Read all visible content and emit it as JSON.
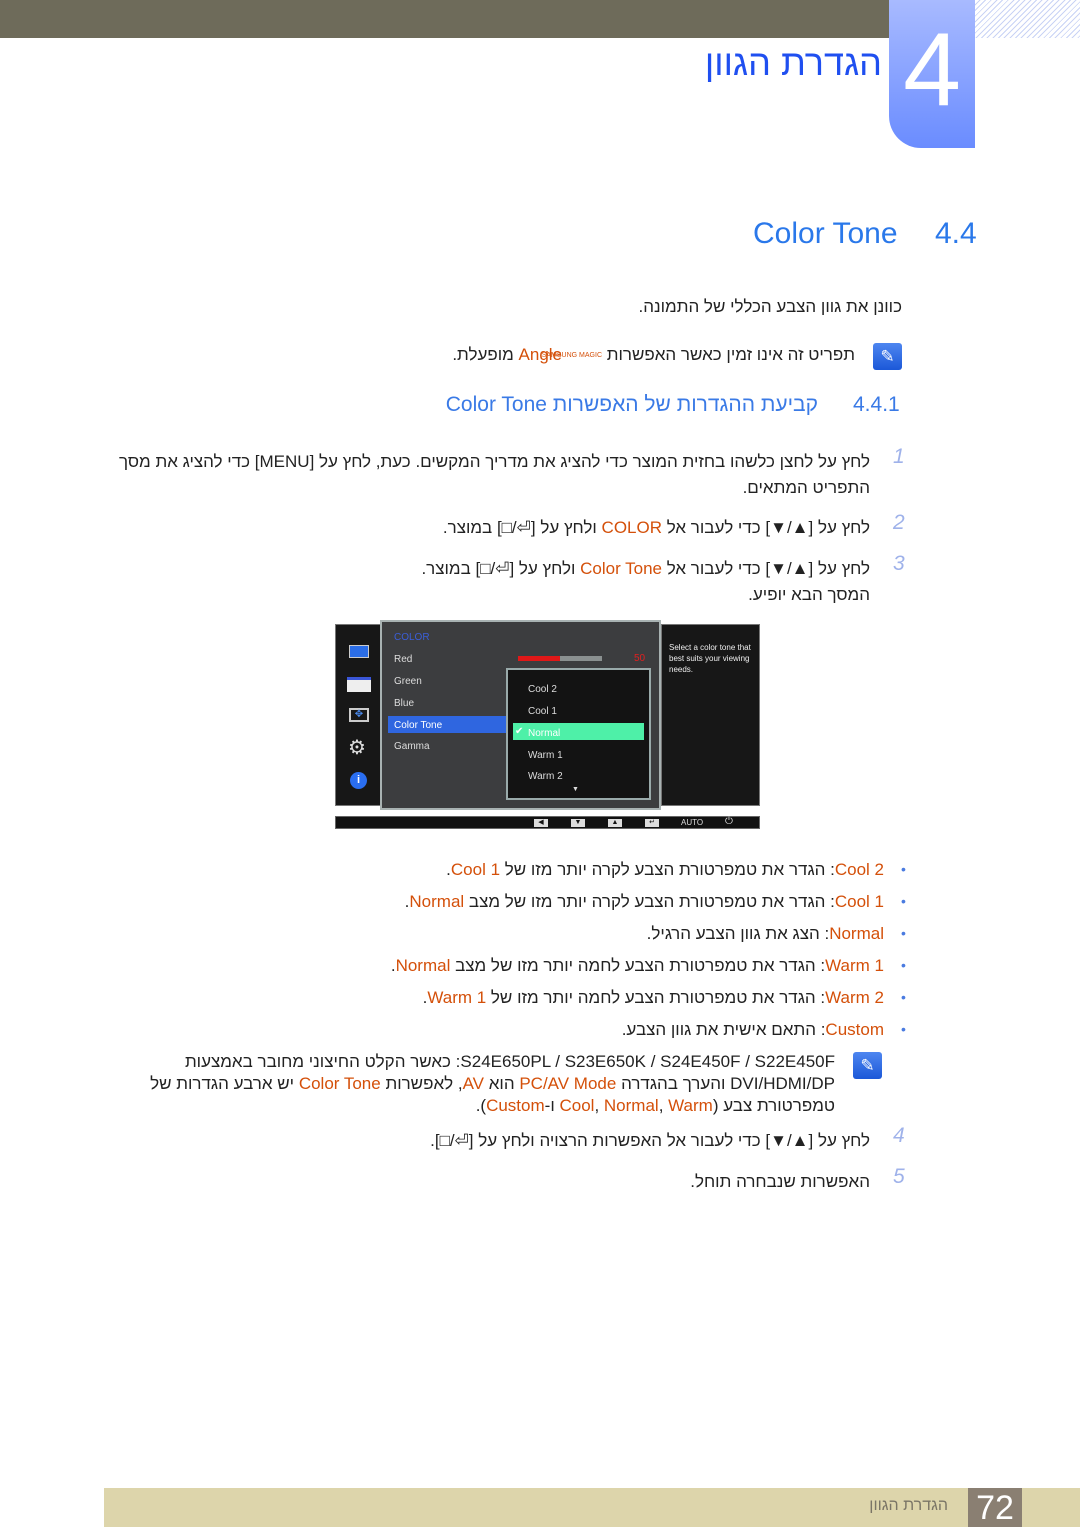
{
  "header": {
    "chapter_number": "4",
    "chapter_title": "הגדרת הגוון"
  },
  "section": {
    "number": "4.4",
    "title": "Color Tone"
  },
  "intro": "כוונן את גוון הצבע הכללי של התמונה.",
  "note1": [
    {
      "t": "תפריט זה אינו זמין כאשר האפשרות "
    },
    {
      "t": "SAMSUNG MAGIC",
      "c": "logo"
    },
    {
      "t": "Angle",
      "c": "o"
    },
    {
      "t": " מופעלת."
    }
  ],
  "subsection": {
    "number": "4.4.1",
    "title": "קביעת ההגדרות של האפשרות Color Tone"
  },
  "steps": [
    {
      "n": "1",
      "lines": [
        [
          {
            "t": "לחץ על לחצן כלשהו בחזית המוצר כדי להציג את מדריך המקשים. כעת, לחץ על [MENU] כדי להציג את מסך"
          }
        ],
        [
          {
            "t": "התפריט המתאים."
          }
        ]
      ]
    },
    {
      "n": "2",
      "lines": [
        [
          {
            "t": "לחץ על [▲/▼] כדי לעבור אל "
          },
          {
            "t": "COLOR",
            "c": "o"
          },
          {
            "t": " ולחץ על [⏎/□] במוצר."
          }
        ]
      ]
    },
    {
      "n": "3",
      "lines": [
        [
          {
            "t": "לחץ על [▲/▼] כדי לעבור אל "
          },
          {
            "t": "Color Tone",
            "c": "o"
          },
          {
            "t": " ולחץ על [⏎/□] במוצר."
          }
        ],
        [
          {
            "t": "המסך הבא יופיע."
          }
        ]
      ]
    },
    {
      "n": "4",
      "lines": [
        [
          {
            "t": "לחץ על [▲/▼] כדי לעבור אל האפשרות הרצויה ולחץ על [⏎/□]."
          }
        ]
      ]
    },
    {
      "n": "5",
      "lines": [
        [
          {
            "t": "האפשרות שנבחרה תוחל."
          }
        ]
      ]
    }
  ],
  "osd": {
    "menu_title": "COLOR",
    "items": [
      "Red",
      "Green",
      "Blue",
      "Color Tone",
      "Gamma"
    ],
    "selected_item": "Color Tone",
    "red_value": "50",
    "red_level": 50,
    "options": [
      "Cool 2",
      "Cool 1",
      "Normal",
      "Warm 1",
      "Warm 2"
    ],
    "selected_option": "Normal",
    "help": "Select a color tone that best suits your viewing needs.",
    "bottom_auto": "AUTO",
    "colors": {
      "highlight": "#2f66e0",
      "option_highlight": "#4ef0a8",
      "title": "#3b5ed8",
      "value": "#e02020"
    }
  },
  "bullets": [
    [
      {
        "t": "Cool 2",
        "c": "o"
      },
      {
        "t": ": הגדר את טמפרטורת הצבע לקרה יותר מזו של "
      },
      {
        "t": "Cool 1",
        "c": "o"
      },
      {
        "t": "."
      }
    ],
    [
      {
        "t": "Cool 1",
        "c": "o"
      },
      {
        "t": ": הגדר את טמפרטורת הצבע לקרה יותר מזו של מצב "
      },
      {
        "t": "Normal",
        "c": "o"
      },
      {
        "t": "."
      }
    ],
    [
      {
        "t": "Normal",
        "c": "o"
      },
      {
        "t": ": הצג את גוון הצבע הרגיל."
      }
    ],
    [
      {
        "t": "Warm 1",
        "c": "o"
      },
      {
        "t": ": הגדר את טמפרטורת הצבע לחמה יותר מזו של מצב "
      },
      {
        "t": "Normal",
        "c": "o"
      },
      {
        "t": "."
      }
    ],
    [
      {
        "t": "Warm 2",
        "c": "o"
      },
      {
        "t": ": הגדר את טמפרטורת הצבע לחמה יותר מזו של "
      },
      {
        "t": "Warm 1",
        "c": "o"
      },
      {
        "t": "."
      }
    ],
    [
      {
        "t": "Custom",
        "c": "o"
      },
      {
        "t": ": התאם אישית את גוון הצבע."
      }
    ]
  ],
  "note2": [
    [
      {
        "t": "S24E650PL / S23E650K / S24E450F / S22E450F: כאשר הקלט החיצוני מחובר באמצעות"
      }
    ],
    [
      {
        "t": "DVI/HDMI/DP והערך בהגדרה "
      },
      {
        "t": "PC/AV Mode",
        "c": "o"
      },
      {
        "t": " הוא "
      },
      {
        "t": "AV",
        "c": "o"
      },
      {
        "t": ", לאפשרות "
      },
      {
        "t": "Color Tone",
        "c": "o"
      },
      {
        "t": " יש ארבע הגדרות של"
      }
    ],
    [
      {
        "t": "טמפרטורת צבע ("
      },
      {
        "t": "Cool",
        "c": "o"
      },
      {
        "t": ", "
      },
      {
        "t": "Normal",
        "c": "o"
      },
      {
        "t": ", "
      },
      {
        "t": "Warm",
        "c": "o"
      },
      {
        "t": " ו-"
      },
      {
        "t": "Custom",
        "c": "o"
      },
      {
        "t": ")."
      }
    ]
  ],
  "footer": {
    "page": "72",
    "label": "הגדרת הגוון"
  },
  "colors": {
    "accent": "#2a78ea",
    "highlight_text": "#d4500a",
    "top_bar": "#6e6b5a",
    "footer": "#ddd5ab"
  }
}
